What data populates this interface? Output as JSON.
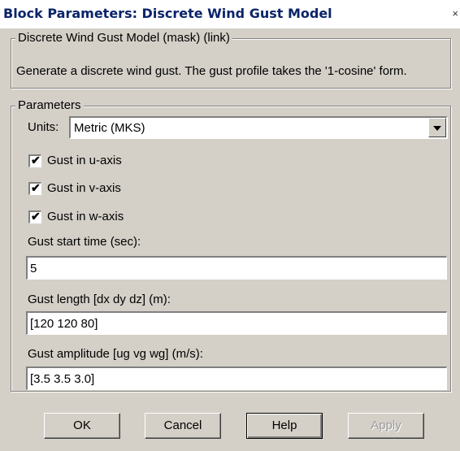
{
  "window": {
    "title": "Block Parameters: Discrete Wind Gust Model",
    "close_glyph": "×"
  },
  "mask_group": {
    "legend": "Discrete Wind Gust Model (mask) (link)",
    "description": "Generate a discrete wind gust. The gust profile takes the '1-cosine' form."
  },
  "params_group": {
    "legend": "Parameters",
    "units_label": "Units:",
    "units_value": "Metric (MKS)",
    "checkboxes": [
      {
        "label": "Gust in u-axis",
        "checked": true
      },
      {
        "label": "Gust in v-axis",
        "checked": true
      },
      {
        "label": "Gust in w-axis",
        "checked": true
      }
    ],
    "fields": [
      {
        "label": "Gust start time (sec):",
        "value": "5"
      },
      {
        "label": "Gust length [dx dy dz] (m):",
        "value": "[120 120 80]"
      },
      {
        "label": "Gust amplitude [ug vg wg] (m/s):",
        "value": "[3.5 3.5 3.0]"
      }
    ]
  },
  "buttons": {
    "ok": "OK",
    "cancel": "Cancel",
    "help": "Help",
    "apply": "Apply"
  },
  "check_glyph": "✔",
  "colors": {
    "dialog_bg": "#d4d0c8",
    "title_text": "#0a246a",
    "disabled_text": "#9a9a9a"
  }
}
